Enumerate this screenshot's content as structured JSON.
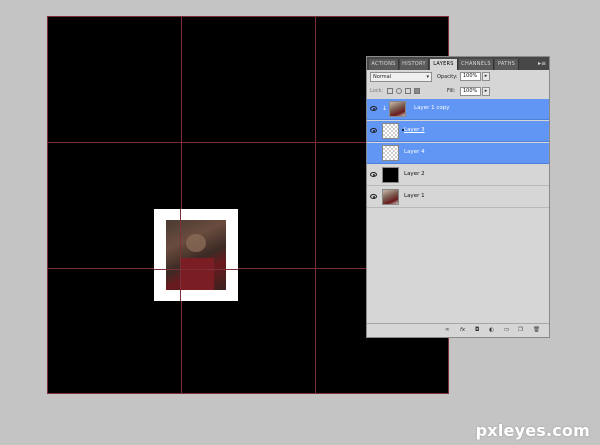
{
  "panel": {
    "tabs": [
      {
        "label": "ACTIONS",
        "active": false
      },
      {
        "label": "HISTORY",
        "active": false
      },
      {
        "label": "LAYERS",
        "active": true
      },
      {
        "label": "CHANNELS",
        "active": false
      },
      {
        "label": "PATHS",
        "active": false
      }
    ],
    "menu_icon": "panel-menu-icon",
    "blend_mode": "Normal",
    "opacity_label": "Opacity:",
    "opacity_value": "100%",
    "lock_label": "Lock:",
    "fill_label": "Fill:",
    "fill_value": "100%",
    "layers": [
      {
        "name": "Layer 1 copy",
        "thumb": "photo",
        "selected": true,
        "clipped": true,
        "visible": true
      },
      {
        "name": "Layer 3",
        "thumb": "transparent",
        "selected": true,
        "clipped": false,
        "visible": true
      },
      {
        "name": "Layer 4",
        "thumb": "transparent",
        "selected": true,
        "clipped": false,
        "visible": false
      },
      {
        "name": "Layer 2",
        "thumb": "black",
        "selected": false,
        "clipped": false,
        "visible": true
      },
      {
        "name": "Layer 1",
        "thumb": "photo",
        "selected": false,
        "clipped": false,
        "visible": true
      }
    ],
    "footer_icons": [
      "link-icon",
      "fx-icon",
      "mask-icon",
      "adjustment-icon",
      "group-icon",
      "new-layer-icon",
      "trash-icon"
    ]
  },
  "watermark": "pxleyes.com",
  "colors": {
    "canvas": "#000000",
    "guide": "#7a2f3b",
    "selected_row": "#6196f5",
    "background": "#c4c4c4"
  }
}
